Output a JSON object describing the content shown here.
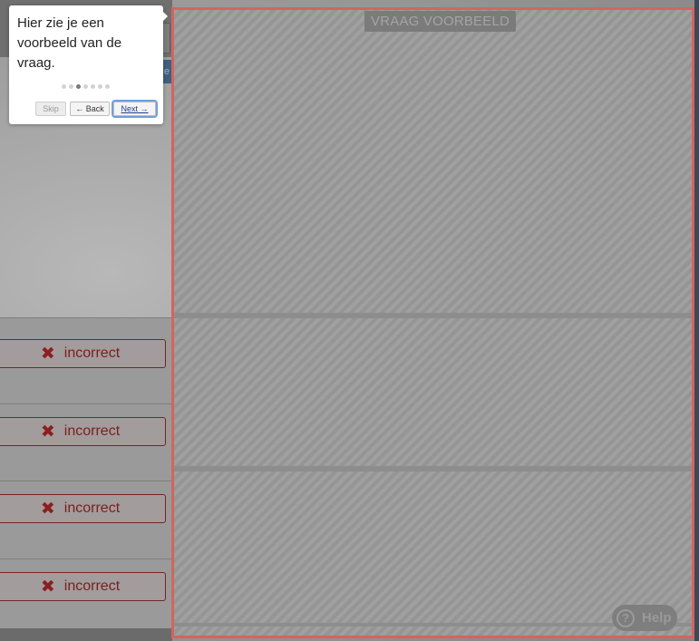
{
  "tour": {
    "text": "Hier zie je een voorbeeld van de vraag.",
    "step_count": 7,
    "active_step": 3,
    "skip_label": "Skip",
    "back_label": "← Back",
    "next_label": "Next →"
  },
  "left": {
    "tab_fragment": "e"
  },
  "answers": [
    {
      "label": "incorrect",
      "icon": "x-icon"
    },
    {
      "label": "incorrect",
      "icon": "x-icon"
    },
    {
      "label": "incorrect",
      "icon": "x-icon"
    },
    {
      "label": "incorrect",
      "icon": "x-icon"
    }
  ],
  "preview": {
    "badge": "VRAAG VOORBEELD"
  },
  "help": {
    "label": "Help",
    "icon": "question-circle-icon"
  },
  "colors": {
    "highlight_border": "#d4645f",
    "incorrect": "#8b1f1f"
  }
}
